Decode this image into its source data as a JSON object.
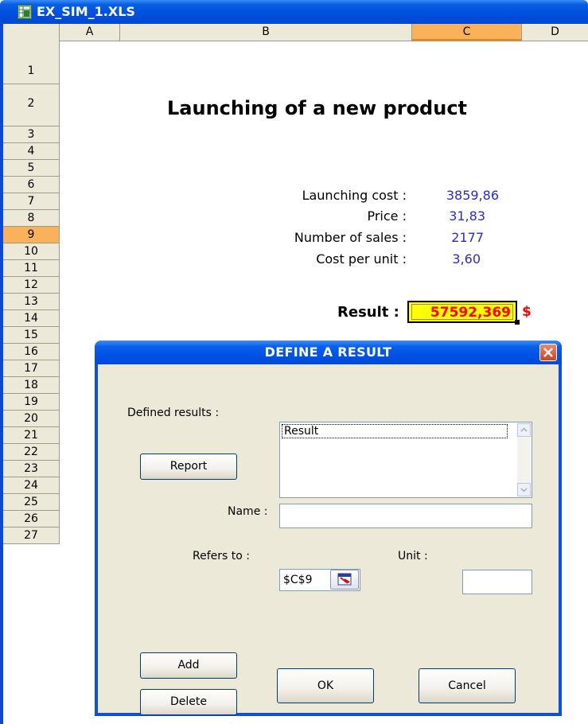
{
  "window": {
    "title": "EX_SIM_1.XLS",
    "icon": "excel-sheet-icon"
  },
  "sheet": {
    "columns": [
      "A",
      "B",
      "C",
      "D"
    ],
    "selected_column": "C",
    "rows": [
      "1",
      "2",
      "3",
      "4",
      "5",
      "6",
      "7",
      "8",
      "9",
      "10",
      "11",
      "12",
      "13",
      "14",
      "15",
      "16",
      "17",
      "18",
      "19",
      "20",
      "21",
      "22",
      "23",
      "24",
      "25",
      "26",
      "27"
    ],
    "selected_row": "9",
    "title": "Launching of a new product",
    "params": [
      {
        "label": "Launching cost :",
        "value": "3859,86"
      },
      {
        "label": "Price :",
        "value": "31,83"
      },
      {
        "label": "Number of sales :",
        "value": "2177"
      },
      {
        "label": "Cost per unit :",
        "value": "3,60"
      }
    ],
    "result": {
      "label": "Result :",
      "value": "57592,369",
      "unit": "$"
    }
  },
  "dialog": {
    "title": "DEFINE A RESULT",
    "defined_results_label": "Defined results :",
    "results_list": [
      "Result"
    ],
    "report_button": "Report",
    "name_label": "Name :",
    "name_value": "",
    "refers_to_label": "Refers to :",
    "refers_to_value": "$C$9",
    "unit_label": "Unit :",
    "unit_value": "",
    "add_button": "Add",
    "delete_button": "Delete",
    "ok_button": "OK",
    "cancel_button": "Cancel"
  }
}
